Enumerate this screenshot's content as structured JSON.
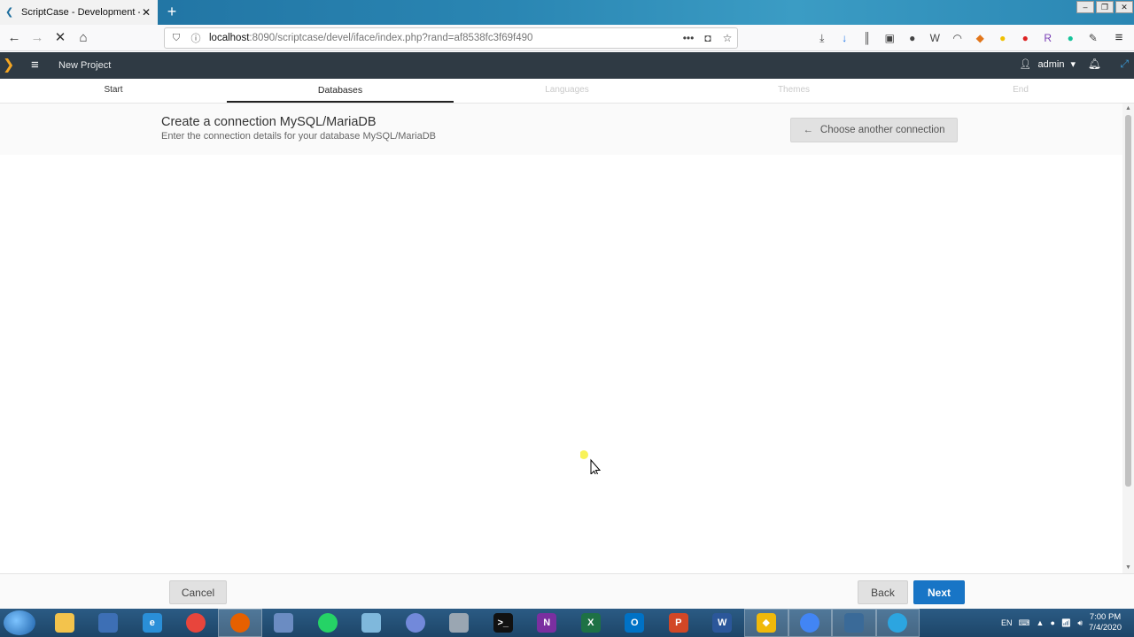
{
  "browser": {
    "tab_title": "ScriptCase - Development - ad",
    "url_host": "localhost",
    "url_path": ":8090/scriptcase/devel/iface/index.php?rand=af8538fc3f69f490"
  },
  "app": {
    "project_title": "New Project",
    "user": "admin"
  },
  "wizard": {
    "steps": [
      {
        "label": "Start",
        "state": "done"
      },
      {
        "label": "Databases",
        "state": "active"
      },
      {
        "label": "Languages",
        "state": "pending"
      },
      {
        "label": "Themes",
        "state": "pending"
      },
      {
        "label": "End",
        "state": "pending"
      }
    ]
  },
  "content": {
    "title": "Create a connection MySQL/MariaDB",
    "subtitle": "Enter the connection details for your database MySQL/MariaDB",
    "choose_button": "Choose another connection"
  },
  "footer": {
    "cancel": "Cancel",
    "back": "Back",
    "next": "Next"
  },
  "taskbar": {
    "lang": "EN",
    "time": "7:00 PM",
    "date": "7/4/2020"
  },
  "colors": {
    "accent": "#1875c6",
    "header_bg": "#2f3a44"
  }
}
